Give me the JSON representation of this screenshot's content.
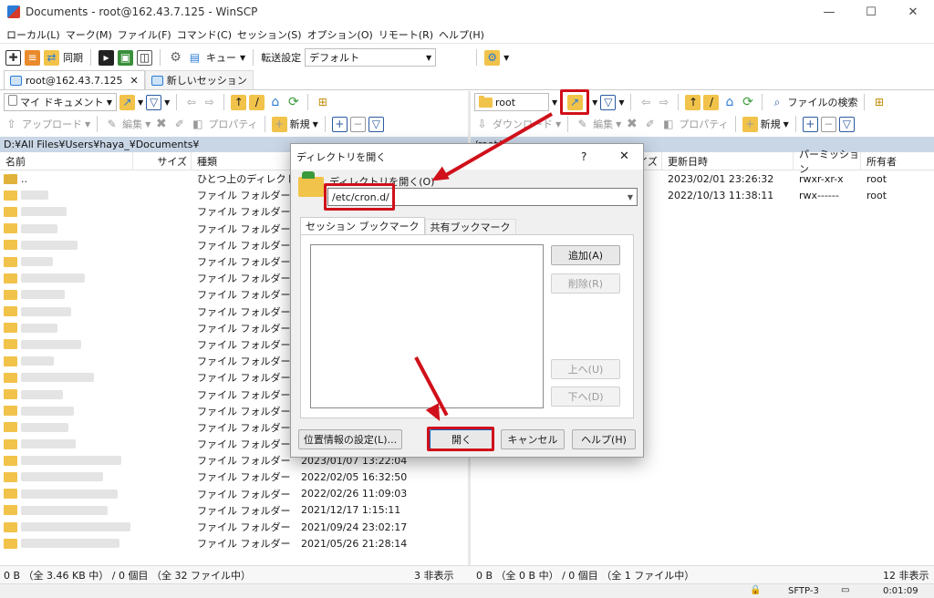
{
  "window": {
    "title": "Documents - root@162.43.7.125 - WinSCP",
    "min": "—",
    "max": "☐",
    "close": "✕"
  },
  "menu": [
    "ローカル(L)",
    "マーク(M)",
    "ファイル(F)",
    "コマンド(C)",
    "セッション(S)",
    "オプション(O)",
    "リモート(R)",
    "ヘルプ(H)"
  ],
  "toolbar": {
    "sync": "同期",
    "queue": "キュー",
    "transfer_label": "転送設定",
    "transfer_value": "デフォルト"
  },
  "tabs": {
    "session": "root@162.43.7.125",
    "new": "新しいセッション"
  },
  "local": {
    "drive": "マイ ドキュメント",
    "upload": "アップロード",
    "edit": "編集",
    "properties": "プロパティ",
    "new": "新規",
    "path": "D:¥All Files¥Users¥haya_¥Documents¥",
    "headers": {
      "name": "名前",
      "size": "サイズ",
      "type": "種類"
    },
    "parent": {
      "name": "..",
      "type": "ひとつ上のディレクトリ"
    },
    "folder_type": "ファイル フォルダー",
    "dates": [
      "2023/01/07  13:22:04",
      "2022/02/05  16:32:50",
      "2022/02/26  11:09:03",
      "2021/12/17  1:15:11",
      "2021/09/24  23:02:17",
      "2021/05/26  21:28:14"
    ],
    "status": "0 B （全 3.46 KB 中） / 0 個目 （全 32 ファイル中）",
    "hidden": "3 非表示"
  },
  "remote": {
    "dir": "root",
    "find": "ファイルの検索",
    "download": "ダウンロード",
    "edit": "編集",
    "properties": "プロパティ",
    "new": "新規",
    "path": "/root/",
    "headers": {
      "size": "イズ",
      "modified": "更新日時",
      "perm": "パーミッション",
      "owner": "所有者"
    },
    "rows": [
      {
        "modified": "2023/02/01 23:26:32",
        "perm": "rwxr-xr-x",
        "owner": "root"
      },
      {
        "modified": "2022/10/13 11:38:11",
        "perm": "rwx------",
        "owner": "root"
      }
    ],
    "status": "0 B （全 0 B 中） / 0 個目 （全 1 ファイル中）",
    "hidden": "12 非表示"
  },
  "bottom": {
    "protocol": "SFTP-3",
    "time": "0:01:09"
  },
  "dialog": {
    "title": "ディレクトリを開く",
    "help_q": "?",
    "close": "✕",
    "label": "ディレクトリを開く(O)",
    "value": "/etc/cron.d/",
    "tab_session": "セッション ブックマーク",
    "tab_shared": "共有ブックマーク",
    "add": "追加(A)",
    "delete": "削除(R)",
    "up": "上へ(U)",
    "down": "下へ(D)",
    "location": "位置情報の設定(L)...",
    "open": "開く",
    "cancel": "キャンセル",
    "help": "ヘルプ(H)"
  },
  "colors": {
    "accent": "#d0101a",
    "path_bg": "#c9d6e6",
    "folder": "#f2c34a"
  }
}
